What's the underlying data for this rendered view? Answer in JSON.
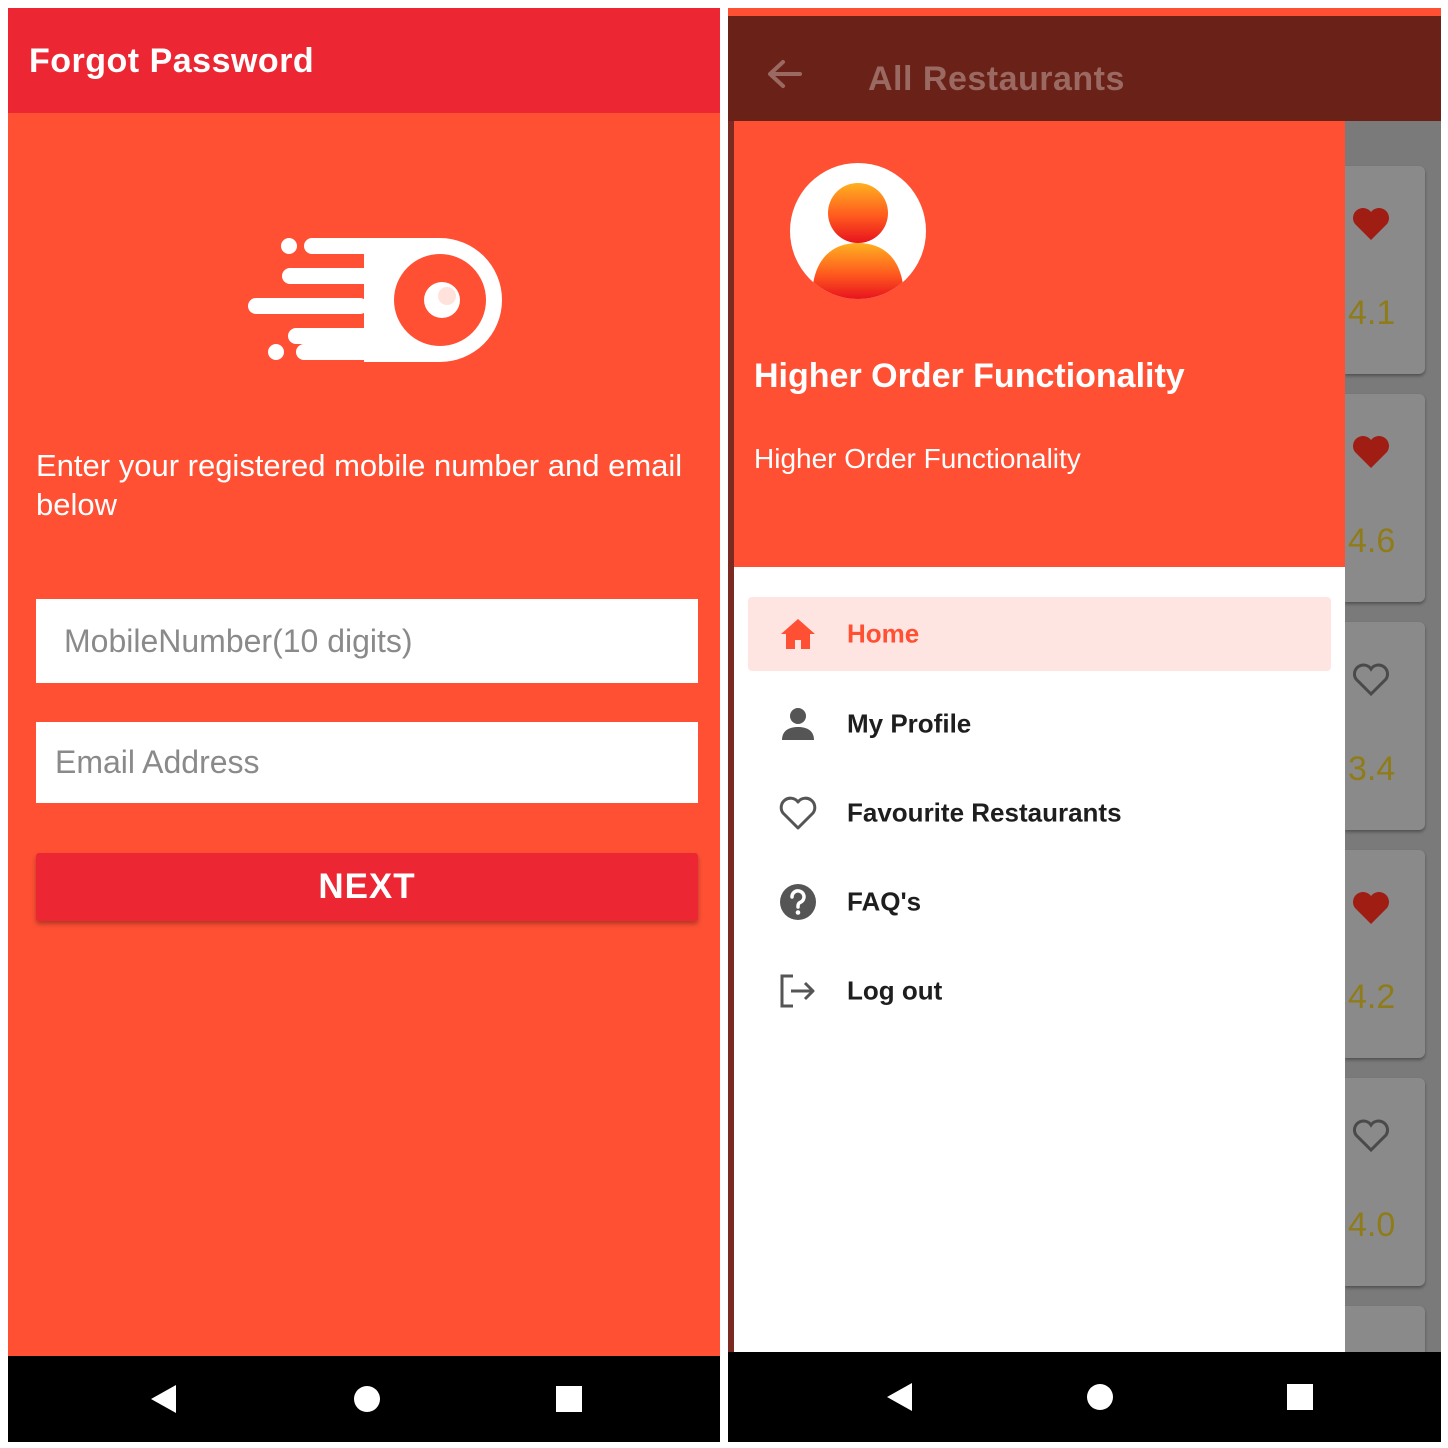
{
  "left_screen": {
    "toolbar_title": "Forgot Password",
    "logo_icon": "app-logo-icon",
    "instruction": "Enter your registered mobile number and email below",
    "mobile_placeholder": "MobileNumber(10 digits)",
    "email_placeholder": "Email Address",
    "next_label": "NEXT",
    "colors": {
      "background": "#FF5034",
      "toolbar": "#EC2733",
      "button": "#EC2733"
    }
  },
  "right_screen": {
    "toolbar_title": "All Restaurants",
    "drawer": {
      "avatar_icon": "user-avatar-icon",
      "name": "Higher Order Functionality",
      "subtitle": "Higher Order Functionality",
      "menu": [
        {
          "label": "Home",
          "icon": "home-icon",
          "active": true
        },
        {
          "label": "My Profile",
          "icon": "person-icon",
          "active": false
        },
        {
          "label": "Favourite Restaurants",
          "icon": "heart-outline-icon",
          "active": false
        },
        {
          "label": "FAQ's",
          "icon": "help-circle-icon",
          "active": false
        },
        {
          "label": "Log out",
          "icon": "logout-icon",
          "active": false
        }
      ]
    },
    "background_cards": [
      {
        "rating": "4.1",
        "favourite": true
      },
      {
        "rating": "4.6",
        "favourite": true
      },
      {
        "rating": "3.4",
        "favourite": false
      },
      {
        "rating": "4.2",
        "favourite": true
      },
      {
        "rating": "4.0",
        "favourite": false
      }
    ],
    "colors": {
      "drawer_header": "#FF5034",
      "active_item_bg": "#FFE5E1",
      "active_item_text": "#FF5034"
    }
  },
  "nav_bar": {
    "buttons": [
      "back-icon",
      "home-circle-icon",
      "recents-square-icon"
    ]
  }
}
